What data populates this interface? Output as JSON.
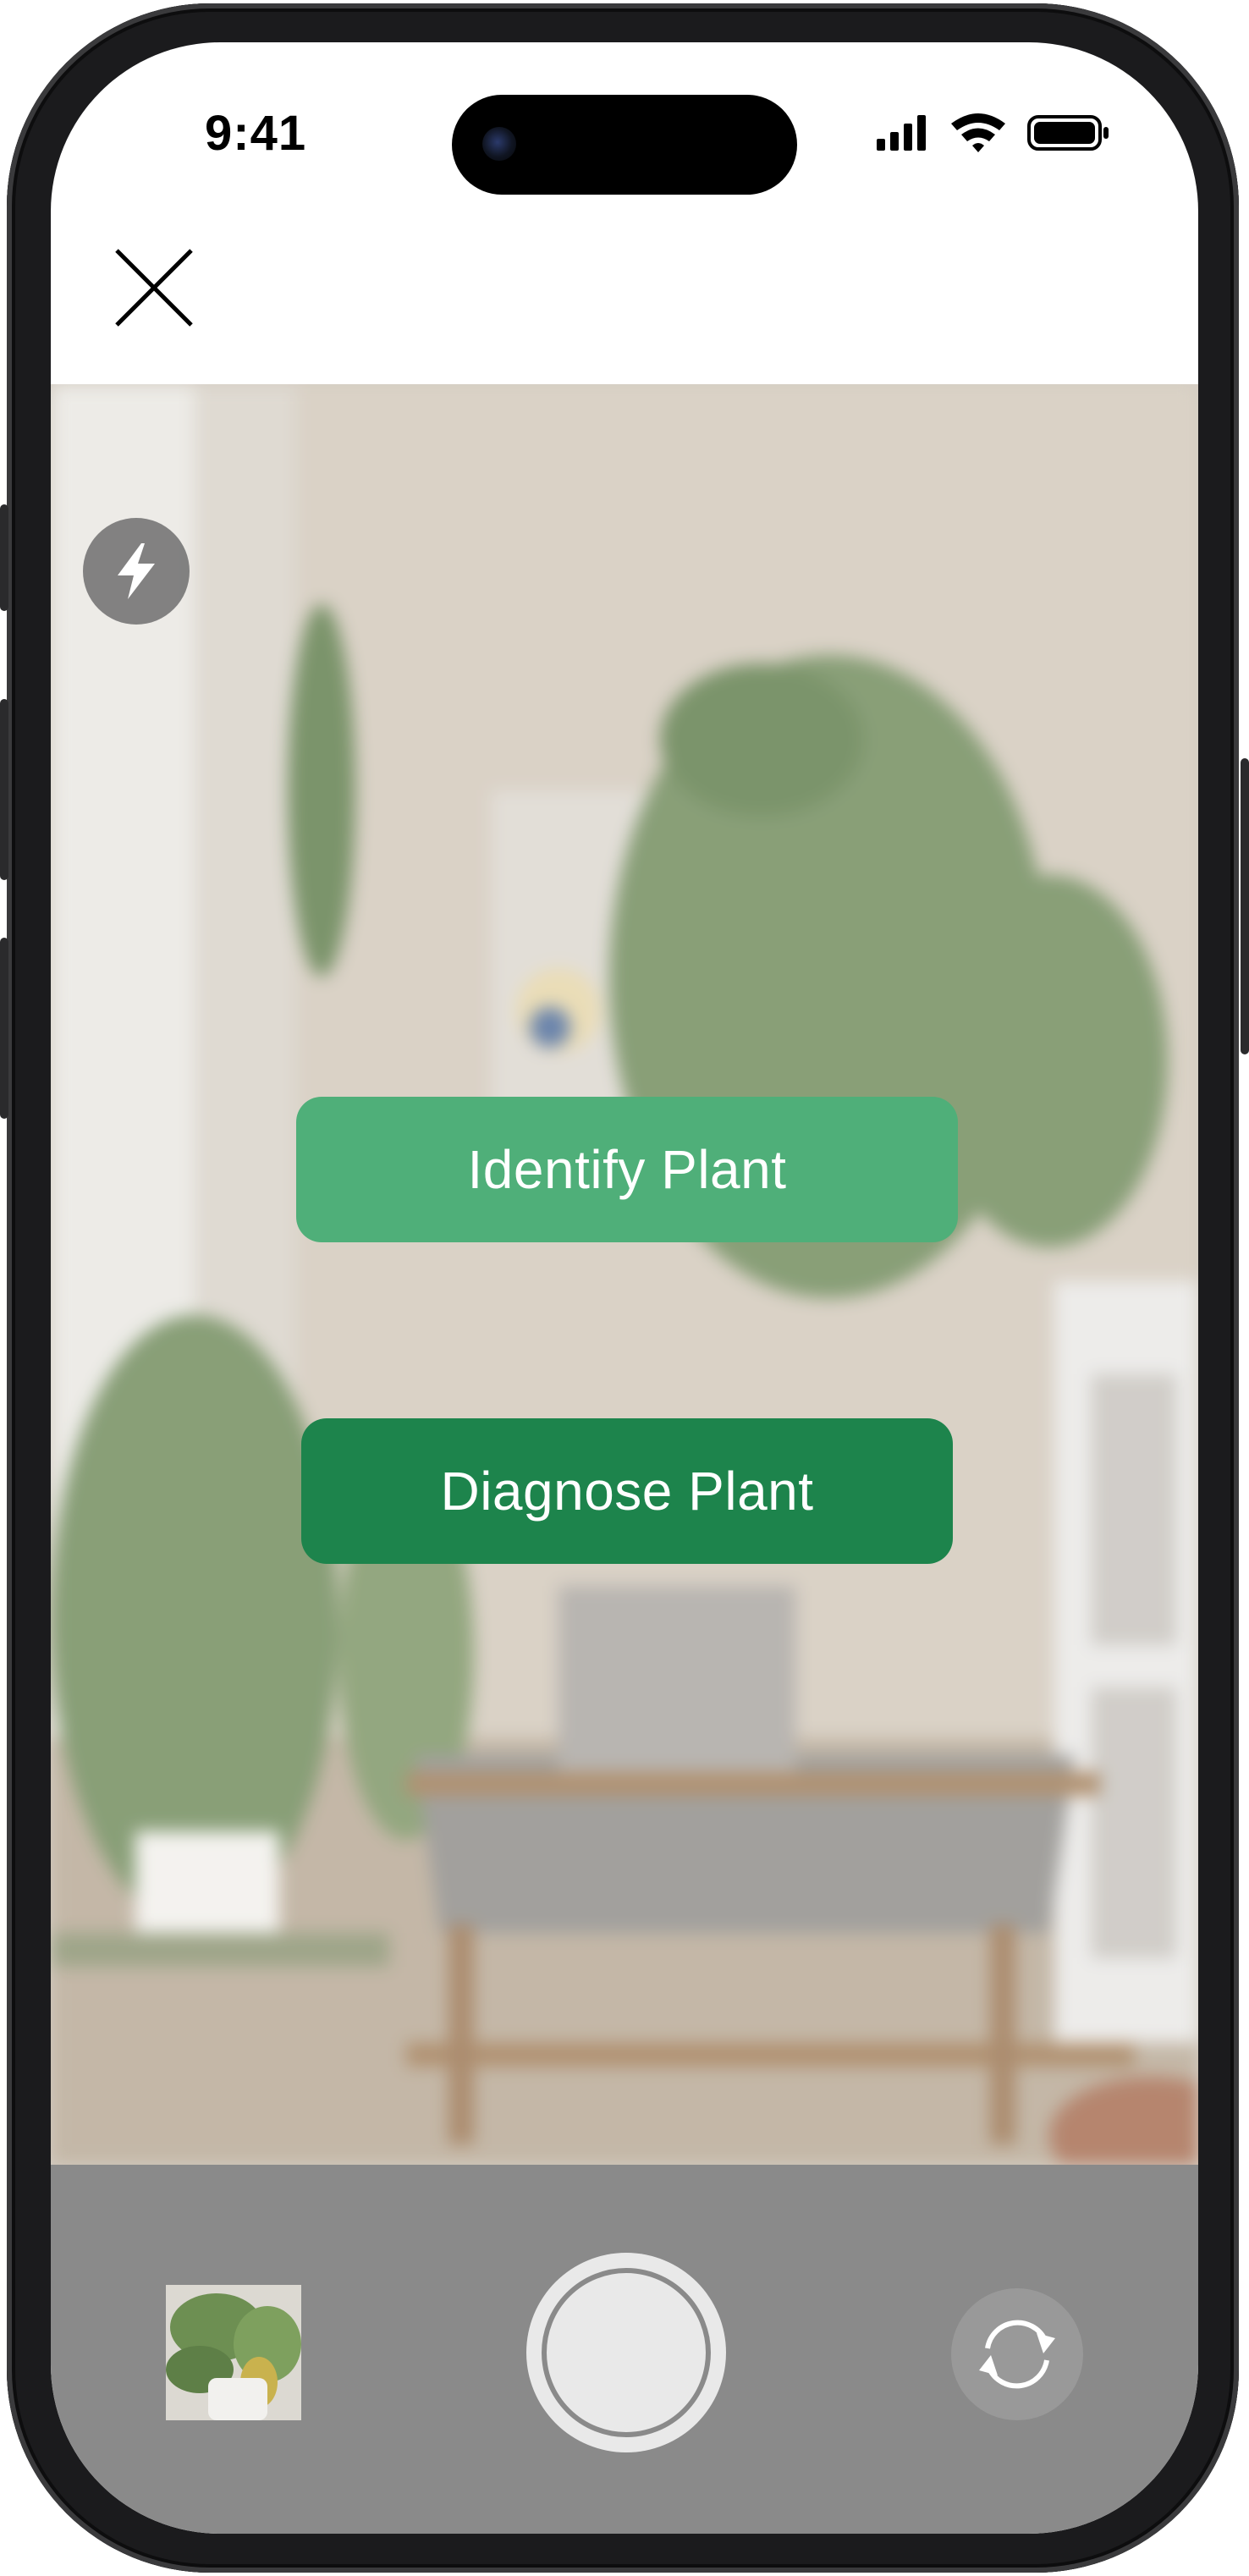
{
  "status_bar": {
    "time": "9:41",
    "icons": [
      "cellular-signal-icon",
      "wifi-icon",
      "battery-icon"
    ]
  },
  "header": {
    "close_icon": "close-icon"
  },
  "camera": {
    "flash_icon": "flash-icon",
    "actions": {
      "identify_label": "Identify Plant",
      "diagnose_label": "Diagnose Plant"
    }
  },
  "controls": {
    "gallery_icon": "gallery-thumbnail",
    "shutter_icon": "shutter-button",
    "flip_icon": "flip-camera-icon"
  },
  "colors": {
    "identify_bg": "#4faf79",
    "diagnose_bg": "#1d844c",
    "bottom_bar": "#8a8a8a"
  }
}
